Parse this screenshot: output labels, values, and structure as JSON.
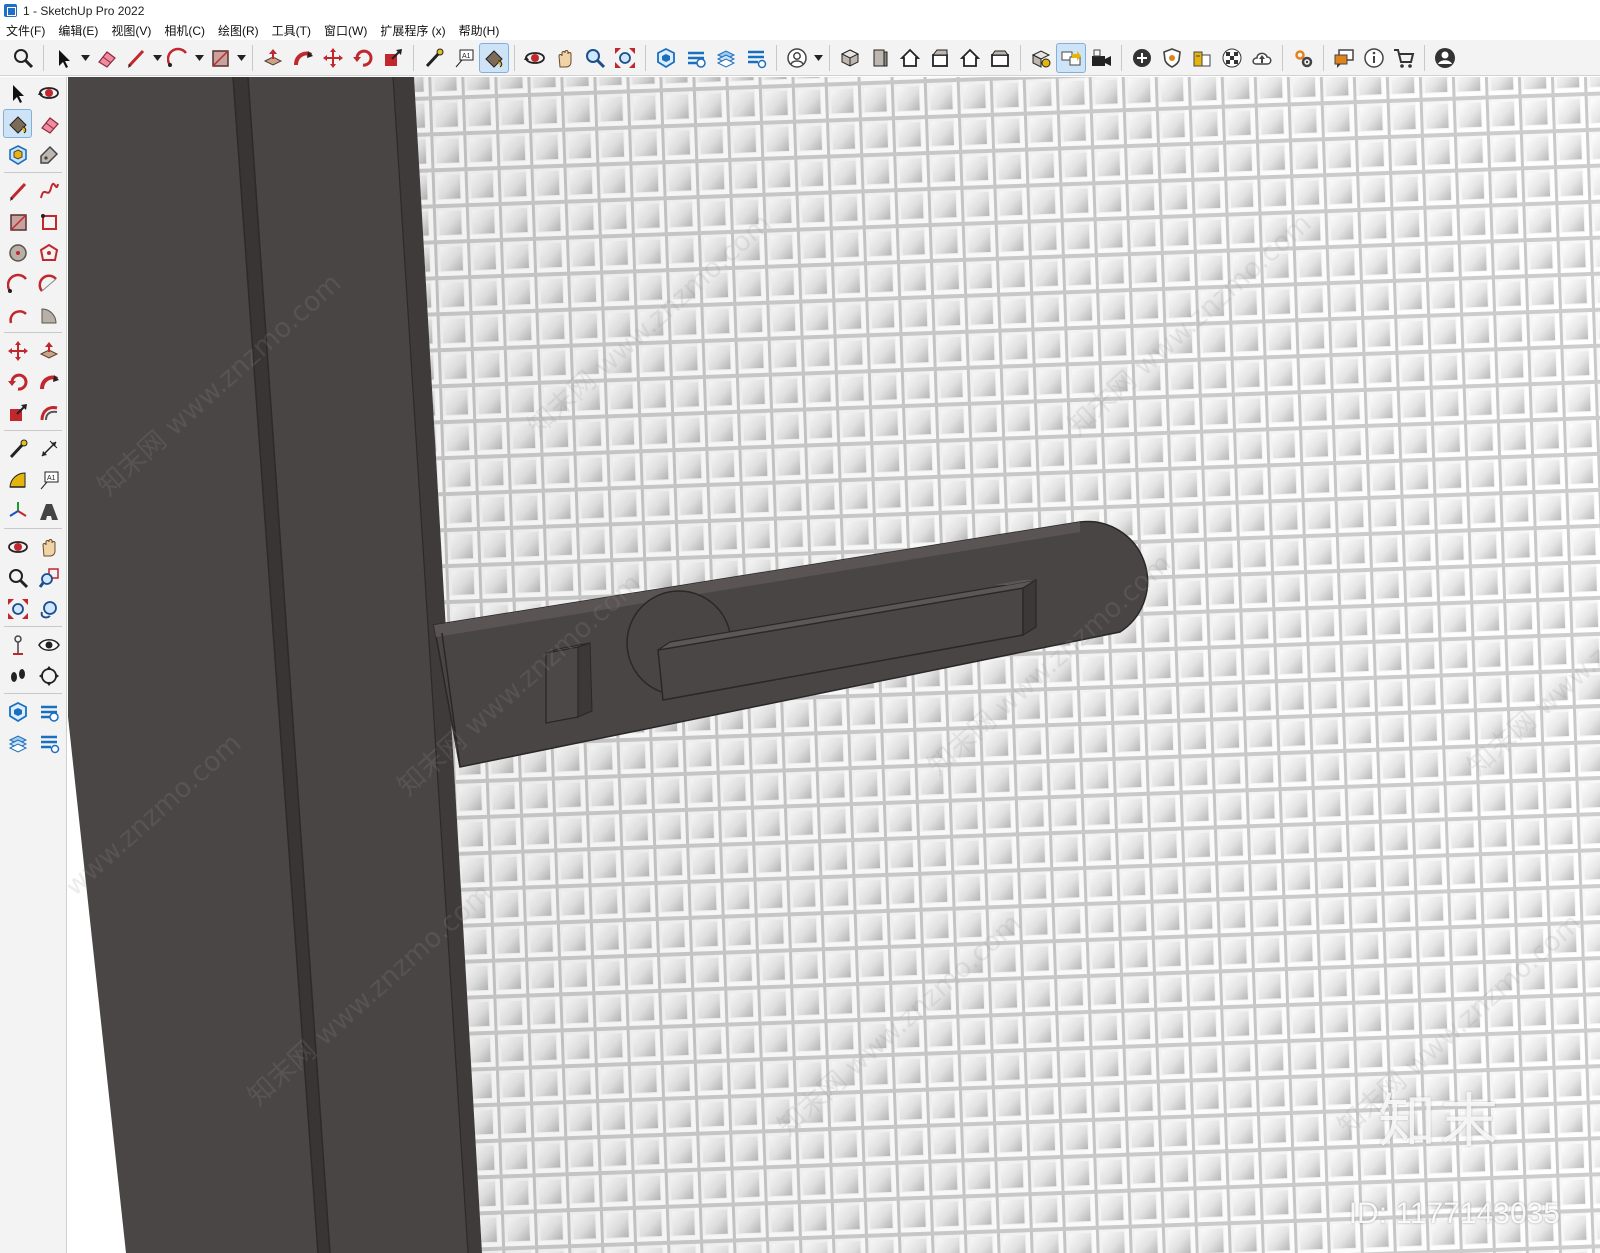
{
  "window": {
    "title": "1 - SketchUp Pro 2022"
  },
  "menu": [
    "文件(F)",
    "编辑(E)",
    "视图(V)",
    "相机(C)",
    "绘图(R)",
    "工具(T)",
    "窗口(W)",
    "扩展程序 (x)",
    "帮助(H)"
  ],
  "toolbar": {
    "groups": [
      [
        {
          "icon": "zoom-icon"
        }
      ],
      [
        {
          "icon": "select-arrow-icon",
          "dropdown": true
        },
        {
          "icon": "eraser-icon"
        },
        {
          "icon": "pencil-line-icon",
          "dropdown": true
        },
        {
          "icon": "arc-icon",
          "dropdown": true
        },
        {
          "icon": "rectangle-icon",
          "dropdown": true
        }
      ],
      [
        {
          "icon": "push-pull-icon"
        },
        {
          "icon": "follow-me-icon"
        },
        {
          "icon": "move-icon"
        },
        {
          "icon": "rotate-icon"
        },
        {
          "icon": "scale-icon"
        }
      ],
      [
        {
          "icon": "tape-measure-icon"
        },
        {
          "icon": "text-label-icon"
        },
        {
          "icon": "paint-bucket-icon",
          "active": true
        }
      ],
      [
        {
          "icon": "orbit-icon"
        },
        {
          "icon": "pan-icon"
        },
        {
          "icon": "zoom-tool-icon"
        },
        {
          "icon": "zoom-extents-icon"
        }
      ],
      [
        {
          "icon": "3d-warehouse-icon"
        },
        {
          "icon": "extension-warehouse-icon"
        },
        {
          "icon": "layout-icon"
        },
        {
          "icon": "extension-manager-icon"
        }
      ],
      [
        {
          "icon": "user-account-icon",
          "dropdown": true
        }
      ],
      [
        {
          "icon": "iso-view-icon"
        },
        {
          "icon": "top-view-icon"
        },
        {
          "icon": "front-view-icon"
        },
        {
          "icon": "right-view-icon"
        },
        {
          "icon": "back-view-icon"
        },
        {
          "icon": "left-view-icon"
        }
      ],
      [
        {
          "icon": "solid-tools-icon"
        },
        {
          "icon": "sandbox-icon",
          "active": true
        },
        {
          "icon": "camera-icon"
        }
      ],
      [
        {
          "icon": "add-location-icon"
        },
        {
          "icon": "shield-icon"
        },
        {
          "icon": "cloud-model-icon"
        },
        {
          "icon": "checker-icon"
        },
        {
          "icon": "upload-icon"
        }
      ],
      [
        {
          "icon": "settings-icon"
        }
      ],
      [
        {
          "icon": "chat-icon"
        },
        {
          "icon": "info-icon"
        },
        {
          "icon": "cart-icon"
        }
      ],
      [
        {
          "icon": "profile-icon"
        }
      ]
    ]
  },
  "palette": {
    "rows": [
      [
        "select-icon",
        "orbit-icon"
      ],
      [
        "paint-bucket-icon",
        "eraser-icon"
      ],
      [
        "component-icon",
        "tag-icon"
      ],
      "sep",
      [
        "pencil-icon",
        "freehand-icon"
      ],
      [
        "rectangle-icon",
        "rotated-rectangle-icon"
      ],
      [
        "circle-icon",
        "polygon-icon"
      ],
      [
        "arc-icon",
        "two-point-arc-icon"
      ],
      [
        "three-point-arc-icon",
        "pie-icon"
      ],
      "sep",
      [
        "move-icon",
        "push-pull-icon"
      ],
      [
        "rotate-icon",
        "follow-me-icon"
      ],
      [
        "scale-icon",
        "offset-icon"
      ],
      "sep",
      [
        "tape-measure-icon",
        "dimension-icon"
      ],
      [
        "protractor-icon",
        "text-icon"
      ],
      [
        "axes-icon",
        "3d-text-icon"
      ],
      "sep",
      [
        "orbit-tool-icon",
        "pan-icon"
      ],
      [
        "zoom-icon",
        "zoom-window-icon"
      ],
      [
        "zoom-extents-icon",
        "previous-view-icon"
      ],
      "sep",
      [
        "position-camera-icon",
        "look-around-icon"
      ],
      [
        "walk-icon",
        "section-plane-icon"
      ],
      "sep",
      [
        "warehouse-icon",
        "extension-warehouse-icon"
      ],
      [
        "layers-icon",
        "extension-manager-icon"
      ]
    ],
    "active": "paint-bucket-icon"
  },
  "scene": {
    "frame_color": "#4a4545",
    "glass_color": "#ececec",
    "watermark_text": "知末网 www.znzmo.com",
    "logo_text": "知末",
    "image_id": "ID: 1177143035"
  }
}
